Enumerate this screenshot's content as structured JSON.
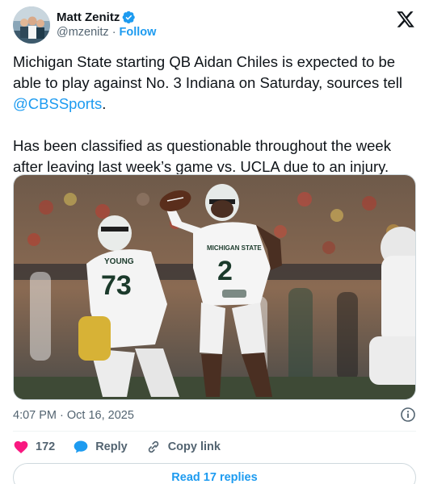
{
  "author": {
    "display_name": "Matt Zenitz",
    "handle": "@mzenitz",
    "separator": "·",
    "follow_label": "Follow",
    "verified": true
  },
  "tweet": {
    "paragraph1_before": "Michigan State starting QB Aidan Chiles is expected to be able to play against No. 3 Indiana on Saturday, sources tell ",
    "paragraph1_mention": "@CBSSports",
    "paragraph1_after": ".",
    "paragraph2": "Has been classified as questionable throughout the week after leaving last week’s game vs. UCLA due to an injury."
  },
  "media": {
    "jersey_main_name": "MICHIGAN STATE",
    "jersey_main_number": "2",
    "jersey_left_name": "YOUNG",
    "jersey_left_number": "73"
  },
  "meta": {
    "timestamp": "4:07 PM · Oct 16, 2025"
  },
  "actions": {
    "like_count": "172",
    "reply_label": "Reply",
    "copy_link_label": "Copy link"
  },
  "replies_button": "Read 17 replies",
  "colors": {
    "accent": "#1d9bf0",
    "like": "#f91880",
    "text": "#0f1419",
    "muted": "#536471"
  },
  "icons": [
    "verified-badge-icon",
    "x-logo-icon",
    "info-icon",
    "heart-icon",
    "reply-bubble-icon",
    "link-icon"
  ]
}
